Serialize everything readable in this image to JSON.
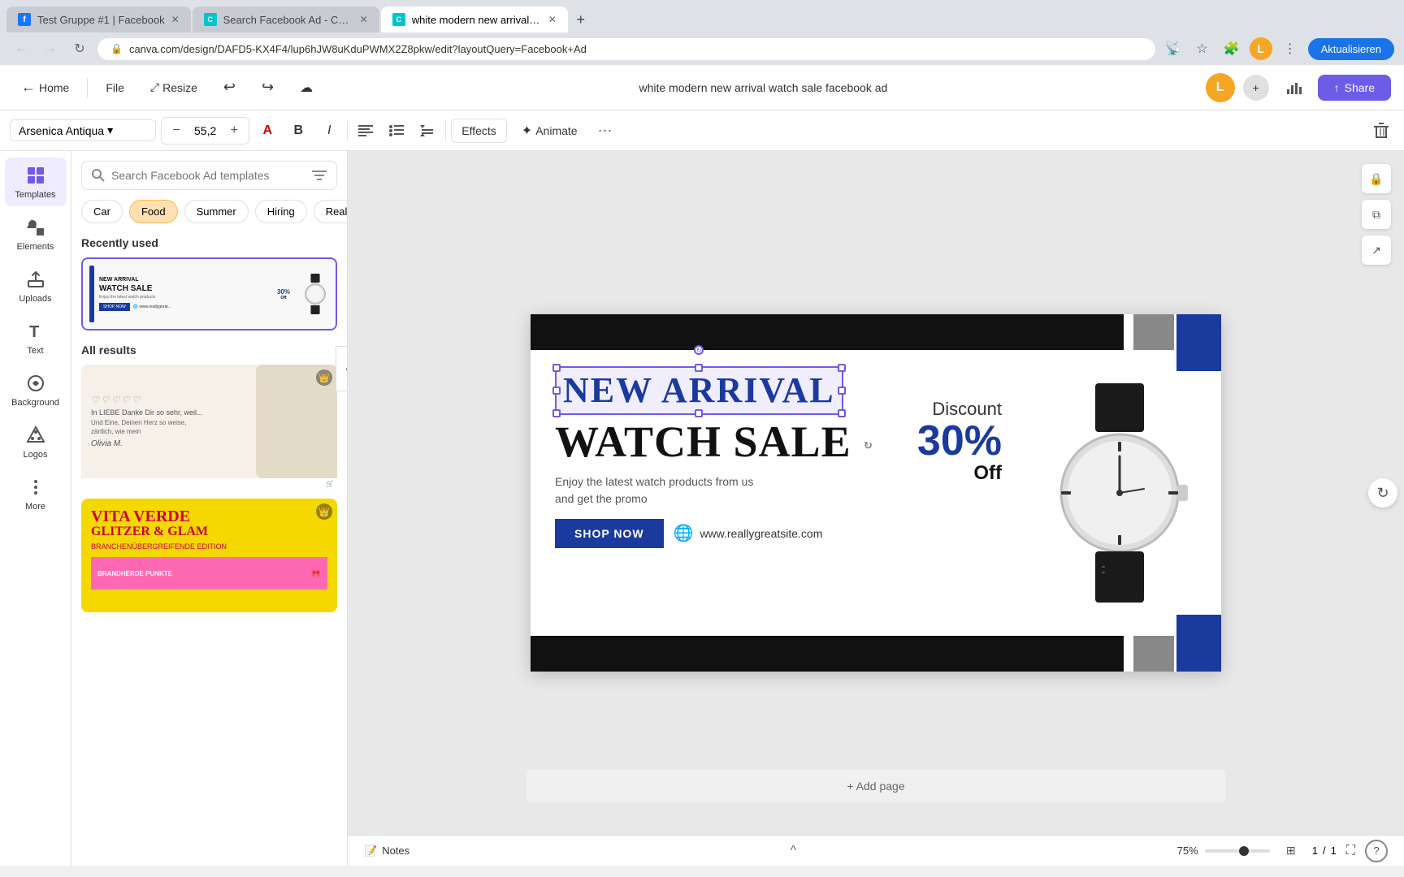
{
  "browser": {
    "tabs": [
      {
        "id": "tab1",
        "title": "Test Gruppe #1 | Facebook",
        "active": false,
        "favicon_color": "#1877f2"
      },
      {
        "id": "tab2",
        "title": "Search Facebook Ad - Canva",
        "active": false,
        "favicon_color": "#00c4cc"
      },
      {
        "id": "tab3",
        "title": "white modern new arrival watc...",
        "active": true,
        "favicon_color": "#00c4cc"
      }
    ],
    "url": "canva.com/design/DAFD5-KX4F4/lup6hJW8uKduPWMX2Z8pkw/edit?layoutQuery=Facebook+Ad",
    "update_button": "Aktualisieren"
  },
  "canva_toolbar": {
    "home_label": "Home",
    "file_label": "File",
    "resize_label": "Resize",
    "doc_title": "white modern new arrival watch sale facebook ad",
    "share_label": "Share"
  },
  "format_toolbar": {
    "font_name": "Arsenica Antiqua",
    "font_size": "55,2",
    "effects_label": "Effects",
    "animate_label": "Animate"
  },
  "sidebar": {
    "items": [
      {
        "id": "templates",
        "label": "Templates",
        "active": true
      },
      {
        "id": "elements",
        "label": "Elements",
        "active": false
      },
      {
        "id": "uploads",
        "label": "Uploads",
        "active": false
      },
      {
        "id": "text",
        "label": "Text",
        "active": false
      },
      {
        "id": "background",
        "label": "Background",
        "active": false
      },
      {
        "id": "logos",
        "label": "Logos",
        "active": false
      },
      {
        "id": "more",
        "label": "More",
        "active": false
      }
    ]
  },
  "templates_panel": {
    "search_placeholder": "Search Facebook Ad templates",
    "categories": [
      "Car",
      "Food",
      "Summer",
      "Hiring",
      "Real e..."
    ],
    "recently_used_title": "Recently used",
    "all_results_title": "All results"
  },
  "canvas": {
    "ad": {
      "new_arrival_text": "NEW ARRIVAL",
      "watch_sale_text": "WATCH SALE",
      "subtitle": "Enjoy the latest watch products from us\nand get the promo",
      "shop_now": "SHOP NOW",
      "website": "www.reallygreatsite.com",
      "discount_label": "Discount",
      "discount_pct": "30%",
      "discount_off": "Off",
      "add_page": "+ Add page"
    }
  },
  "bottom_bar": {
    "notes_label": "Notes",
    "zoom_level": "75%",
    "page_current": "1",
    "page_total": "1"
  }
}
